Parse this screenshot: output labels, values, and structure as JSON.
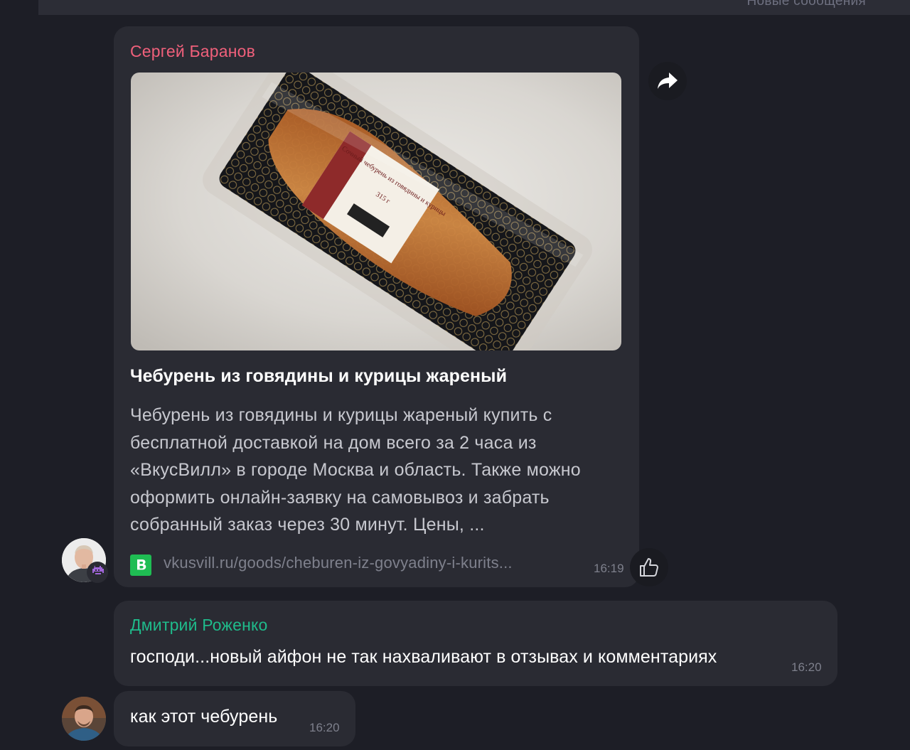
{
  "top_bar": {
    "label": "Новые сообщения"
  },
  "messages": [
    {
      "sender": "Сергей Баранов",
      "sender_color": "#f0607b",
      "link_preview": {
        "title": "Чебурень из говядины и курицы жареный",
        "description": "Чебурень из говядины и курицы жареный купить с бесплатной доставкой на дом всего за 2 часа из «ВкусВилл» в городе Москва и область. Также можно оформить онлайн-заявку на самовывоз и забрать собранный заказ через 30 минут. Цены, ...",
        "url": "vkusvill.ru/goods/cheburen-iz-govyadiny-i-kurits...",
        "site_icon": "vkusvill-logo-icon",
        "image_label": "Сочный чебурень из говядины и курицы",
        "image_weight": "315 г"
      },
      "time": "16:19",
      "actions": [
        "share-icon",
        "thumbs-up-icon"
      ]
    },
    {
      "sender": "Дмитрий Роженко",
      "sender_color": "#1fbb8b",
      "text": "господи...новый айфон не так нахваливают в отзывах и комментариях",
      "time": "16:20"
    },
    {
      "text": "как этот чебурень",
      "time": "16:20"
    }
  ],
  "colors": {
    "background": "#1d1e26",
    "bubble": "#2a2b33",
    "site_green": "#1fbd53"
  }
}
